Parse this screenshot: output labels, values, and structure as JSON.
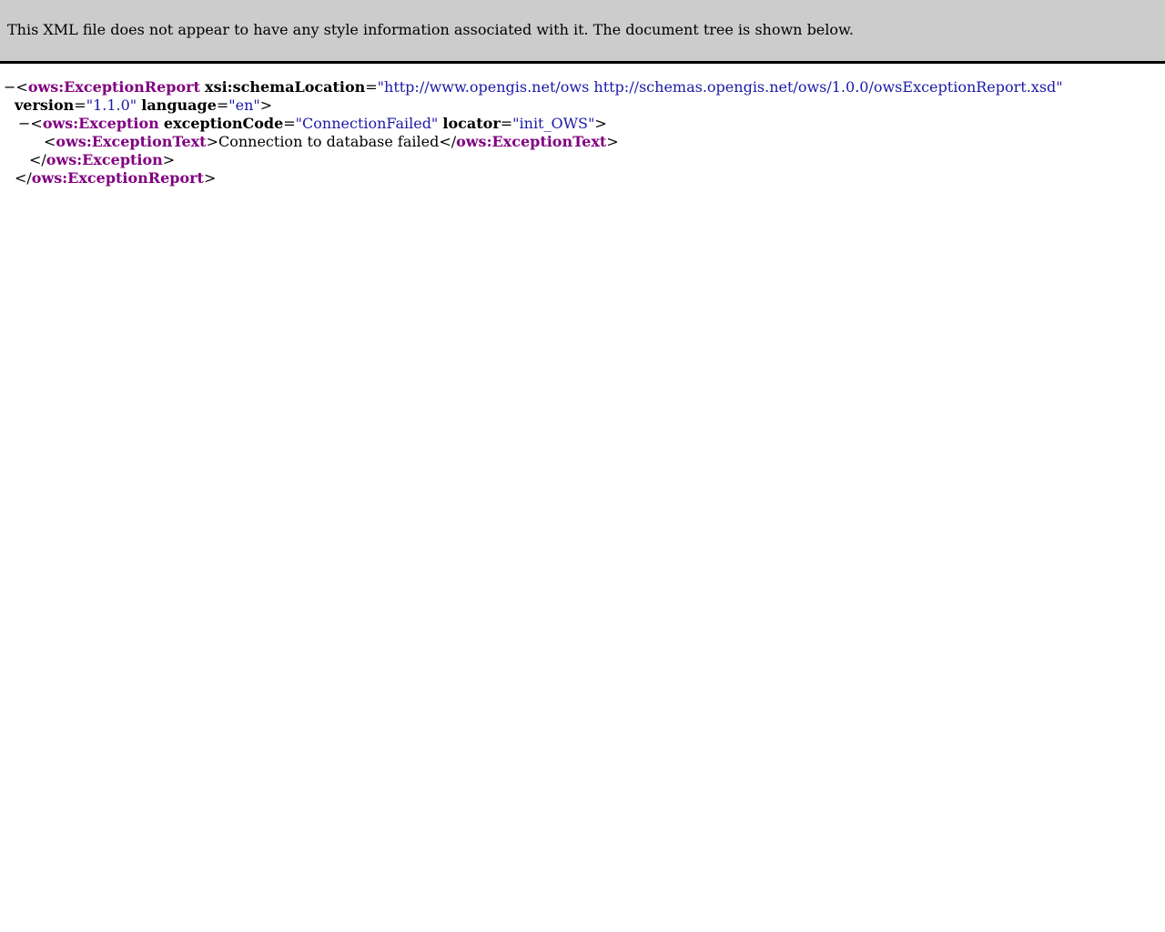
{
  "info_bar": {
    "message": "This XML file does not appear to have any style information associated with it. The document tree is shown below."
  },
  "tree": {
    "fold_glyph": "−",
    "root": {
      "tag": "ows:ExceptionReport",
      "attrs": [
        {
          "name": "xsi:schemaLocation",
          "value": "\"http://www.opengis.net/ows http://schemas.opengis.net/ows/1.0.0/owsExceptionReport.xsd\""
        },
        {
          "name": "version",
          "value": "\"1.1.0\""
        },
        {
          "name": "language",
          "value": "\"en\""
        }
      ]
    },
    "exception": {
      "tag": "ows:Exception",
      "attrs": [
        {
          "name": "exceptionCode",
          "value": "\"ConnectionFailed\""
        },
        {
          "name": "locator",
          "value": "\"init_OWS\""
        }
      ]
    },
    "exception_text": {
      "tag": "ows:ExceptionText",
      "content": "Connection to database failed"
    }
  }
}
